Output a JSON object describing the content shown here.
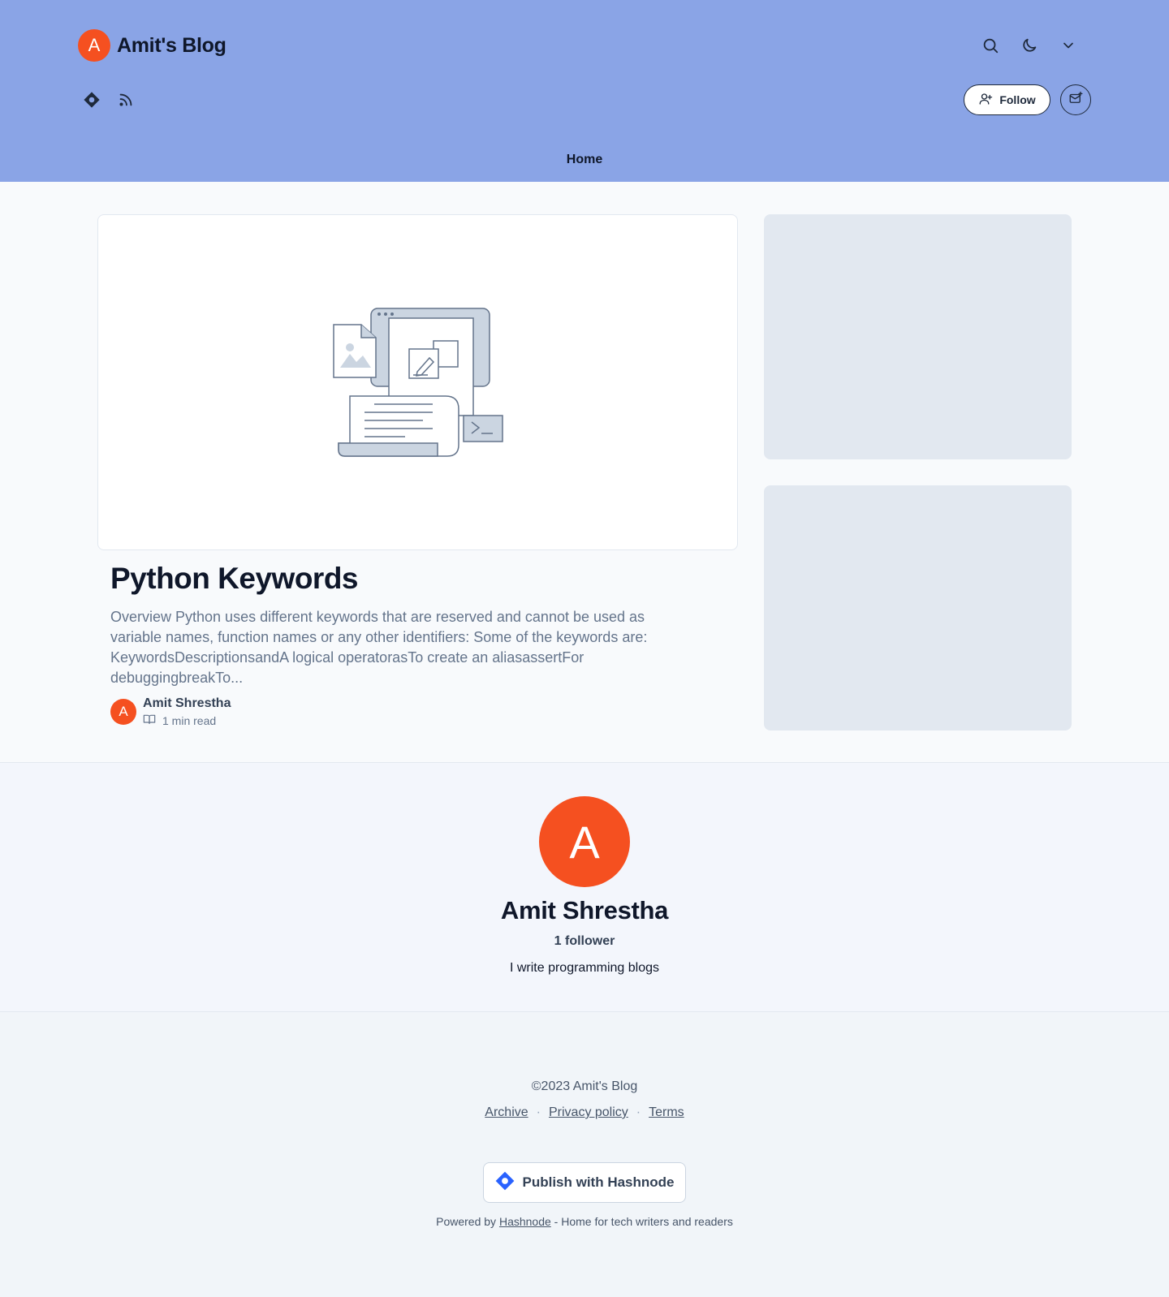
{
  "header": {
    "brand_initial": "A",
    "blog_title": "Amit's Blog",
    "follow_label": "Follow",
    "nav_home": "Home"
  },
  "icons": {
    "search": "search-icon",
    "theme": "moon-icon",
    "menu": "chevron-down-icon",
    "hashnode": "hashnode-icon",
    "rss": "rss-icon",
    "follow": "user-plus-icon",
    "newsletter": "mail-icon",
    "read": "book-open-icon"
  },
  "post": {
    "title": "Python Keywords",
    "excerpt": "Overview Python uses different keywords that are reserved and cannot be used as variable names, function names or any other identifiers: Some of the keywords are: KeywordsDescriptionsandA logical operatorasTo create an aliasassertFor debuggingbreakTo...",
    "author_initial": "A",
    "author_name": "Amit Shrestha",
    "read_time": "1 min read"
  },
  "author_section": {
    "initial": "A",
    "name": "Amit Shrestha",
    "followers": "1 follower",
    "bio": "I write programming blogs"
  },
  "footer": {
    "copyright": "©2023 Amit's Blog",
    "links": [
      "Archive",
      "Privacy policy",
      "Terms"
    ],
    "separator": "·",
    "publish_label": "Publish with Hashnode",
    "powered_prefix": "Powered by",
    "powered_link": "Hashnode",
    "powered_suffix": "- Home for tech writers and readers"
  },
  "colors": {
    "header_bg": "#8aa4e6",
    "avatar_bg": "#f55020",
    "placeholder_bg": "#e2e8f0",
    "hashnode_blue": "#2962ff"
  }
}
